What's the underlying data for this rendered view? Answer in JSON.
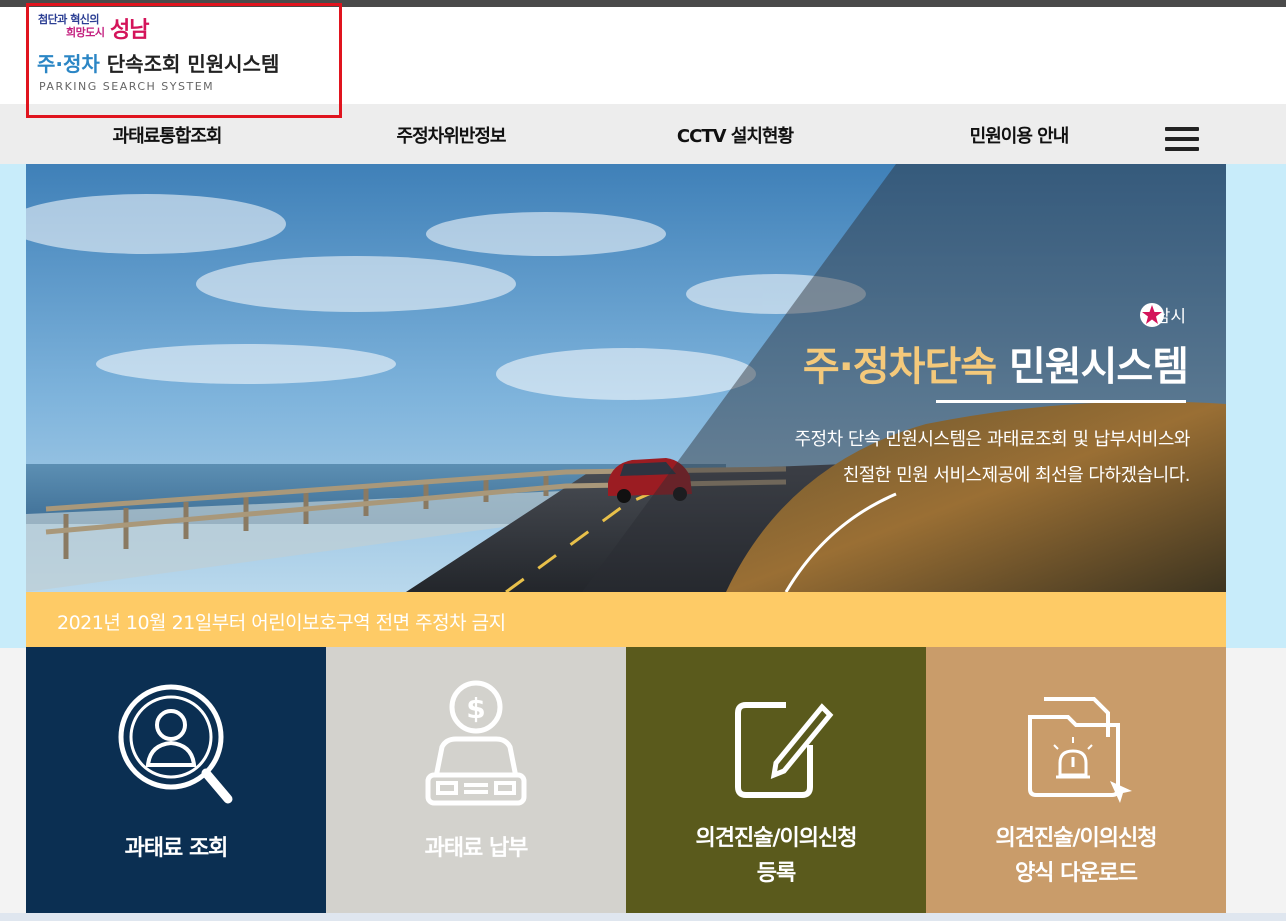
{
  "logo": {
    "slogan_line1": "첨단과 혁신의",
    "slogan_line2": "희망도시",
    "slogan_city": "성남",
    "title_blue": "주·정차",
    "title_rest": " 단속조회 민원시스템",
    "subtitle": "PARKING SEARCH SYSTEM"
  },
  "nav": {
    "items": [
      {
        "label": "과태료통합조회"
      },
      {
        "label": "주정차위반정보"
      },
      {
        "label": "CCTV 설치현황"
      },
      {
        "label": "민원이용 안내"
      }
    ],
    "menu_icon": "hamburger-icon"
  },
  "hero": {
    "badge": "성남시",
    "title_gold": "주·정차단속",
    "title_white": " 민원시스템",
    "desc_line1": "주정차 단속 민원시스템은 과태료조회 및 납부서비스와",
    "desc_line2": "친절한 민원 서비스제공에 최선을 다하겠습니다."
  },
  "notice": {
    "text": "2021년 10월 21일부터 어린이보호구역 전면 주정차 금지"
  },
  "tiles": [
    {
      "line1": "과태료 조회",
      "line2": "",
      "icon": "search-person-icon",
      "color": "#0b2f52"
    },
    {
      "line1": "과태료 납부",
      "line2": "",
      "icon": "car-payment-icon",
      "color": "#d3d2cd"
    },
    {
      "line1": "의견진술/이의신청",
      "line2": "등록",
      "icon": "edit-note-icon",
      "color": "#5a5a1c"
    },
    {
      "line1": "의견진술/이의신청",
      "line2": "양식 다운로드",
      "icon": "folder-alert-icon",
      "color": "#c99c6a"
    }
  ],
  "colors": {
    "accent_blue": "#2b86c5",
    "notice_bg": "#fecb66",
    "hero_gold": "#f4c97b",
    "logo_border": "#e0141e"
  }
}
